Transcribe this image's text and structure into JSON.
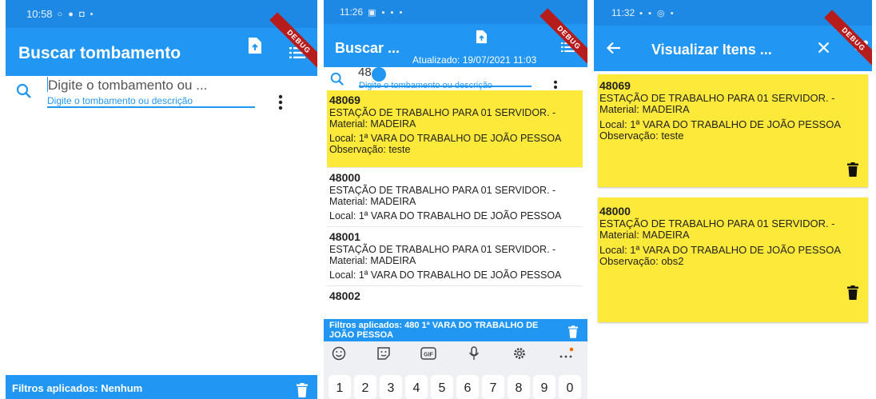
{
  "screen1": {
    "status": {
      "time": "10:58",
      "icons": "○ ● ◘ •"
    },
    "debug_banner": "DEBUG",
    "app_title": "Buscar tombamento",
    "search": {
      "value": "Digite o tombamento ou ...",
      "hint": "Digite o tombamento ou descrição"
    },
    "filters_label": "Filtros aplicados: Nenhum",
    "accent": "#2196f3"
  },
  "screen2": {
    "status": {
      "time": "11:26",
      "icons": "▣ ▪ ▪ •"
    },
    "debug_banner": "DEBUG",
    "app_title": "Buscar ...",
    "updated": "Atualizado: 19/07/2021 11:03",
    "search": {
      "value": "48",
      "hint": "Digite o tombamento ou descrição"
    },
    "items": [
      {
        "code": "48069",
        "desc": "ESTAÇÃO DE TRABALHO PARA 01 SERVIDOR. -",
        "material": "Material: MADEIRA",
        "local": "Local: 1ª VARA DO TRABALHO DE JOÃO PESSOA",
        "obs": "Observação: teste",
        "highlighted": true
      },
      {
        "code": "48000",
        "desc": "ESTAÇÃO DE TRABALHO PARA 01 SERVIDOR. -",
        "material": "Material: MADEIRA",
        "local": "Local: 1ª VARA DO TRABALHO DE JOÃO PESSOA",
        "obs": "",
        "highlighted": false
      },
      {
        "code": "48001",
        "desc": "ESTAÇÃO DE TRABALHO PARA 01 SERVIDOR. -",
        "material": "Material: MADEIRA",
        "local": "Local: 1ª VARA DO TRABALHO DE JOÃO PESSOA",
        "obs": "",
        "highlighted": false
      },
      {
        "code": "48002",
        "desc": "",
        "material": "",
        "local": "",
        "obs": "",
        "highlighted": false
      }
    ],
    "filters_label": "Filtros aplicados: 480 1ª VARA DO TRABALHO DE JOÃO PESSOA",
    "keyboard": {
      "tools": [
        "emoji-icon",
        "sticker-icon",
        "gif-icon",
        "mic-icon",
        "settings-icon",
        "more-icon"
      ],
      "gif_label": "GIF",
      "keys": [
        "1",
        "2",
        "3",
        "4",
        "5",
        "6",
        "7",
        "8",
        "9",
        "0"
      ]
    }
  },
  "screen3": {
    "status": {
      "time": "11:32",
      "icons": "▪ ▪ ◎ •"
    },
    "debug_banner": "DEBUG",
    "app_title": "Visualizar Itens ...",
    "cards": [
      {
        "code": "48069",
        "desc": "ESTAÇÃO DE TRABALHO PARA 01 SERVIDOR. -",
        "material": "Material: MADEIRA",
        "local": "Local: 1ª VARA DO TRABALHO DE JOÃO PESSOA",
        "obs": "Observação: teste"
      },
      {
        "code": "48000",
        "desc": "ESTAÇÃO DE TRABALHO PARA 01 SERVIDOR. -",
        "material": "Material: MADEIRA",
        "local": "Local: 1ª VARA DO TRABALHO DE JOÃO PESSOA",
        "obs": "Observação: obs2"
      }
    ],
    "card_color": "#fde93a"
  }
}
